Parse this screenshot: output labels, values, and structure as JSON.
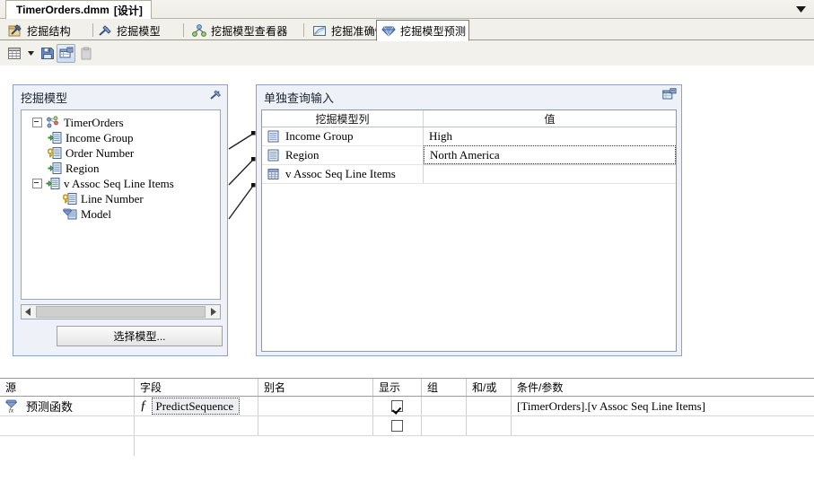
{
  "window": {
    "document_tab_title": "TimerOrders.dmm",
    "document_tab_suffix": "[设计]",
    "chevron_icon": "chevron-down-icon"
  },
  "designer_tabs": [
    {
      "label": "挖掘结构",
      "icon": "mining-structure-icon",
      "active": false
    },
    {
      "label": "挖掘模型",
      "icon": "mining-model-icon",
      "active": false
    },
    {
      "label": "挖掘模型查看器",
      "icon": "mining-model-viewer-icon",
      "active": false
    },
    {
      "label": "挖掘准确性图表",
      "icon": "mining-accuracy-chart-icon",
      "active": false
    },
    {
      "label": "挖掘模型预测",
      "icon": "mining-model-prediction-icon",
      "active": true
    }
  ],
  "toolbar": {
    "buttons": [
      {
        "name": "view-grid-button",
        "icon": "grid-icon",
        "state": "normal"
      },
      {
        "name": "view-dropdown-button",
        "icon": "chevron-down-icon",
        "state": "normal"
      },
      {
        "name": "save-button",
        "icon": "save-icon",
        "state": "normal"
      },
      {
        "name": "singleton-query-button",
        "icon": "singleton-query-icon",
        "state": "pressed"
      },
      {
        "name": "paste-button",
        "icon": "paste-icon",
        "state": "disabled"
      }
    ]
  },
  "mining_model_panel": {
    "title": "挖掘模型",
    "collapse_icon": "collapse-chevron-icon",
    "tree": [
      {
        "label": "TimerOrders",
        "level": 0,
        "icon": "mining-model-node-icon",
        "expander": "minus"
      },
      {
        "label": "Income Group",
        "level": 1,
        "icon": "input-column-icon",
        "expander": null
      },
      {
        "label": "Order Number",
        "level": 1,
        "icon": "key-column-icon",
        "expander": null
      },
      {
        "label": "Region",
        "level": 1,
        "icon": "input-column-icon",
        "expander": null
      },
      {
        "label": "v Assoc Seq Line Items",
        "level": 1,
        "icon": "input-column-icon",
        "expander": "minus"
      },
      {
        "label": "Line Number",
        "level": 2,
        "icon": "key-column-icon",
        "expander": null
      },
      {
        "label": "Model",
        "level": 2,
        "icon": "predict-column-icon",
        "expander": null
      }
    ],
    "scrollbar": {
      "left_arrow": "◄",
      "right_arrow": "►"
    },
    "select_model_button": "选择模型..."
  },
  "query_input_panel": {
    "title": "单独查询输入",
    "corner_icon": "restore-window-icon",
    "columns": [
      "挖掘模型列",
      "值"
    ],
    "rows": [
      {
        "column": "Income Group",
        "value": "High",
        "icon": "table-column-icon",
        "selected": false
      },
      {
        "column": "Region",
        "value": "North America",
        "icon": "table-column-icon",
        "selected": true
      },
      {
        "column": "v Assoc Seq Line Items",
        "value": "",
        "icon": "nested-table-icon",
        "selected": false
      }
    ]
  },
  "query_builder_grid": {
    "columns": [
      "源",
      "字段",
      "别名",
      "显示",
      "组",
      "和/或",
      "条件/参数"
    ],
    "rows": [
      {
        "source": "预测函数",
        "source_icon": "prediction-function-icon",
        "field": "PredictSequence",
        "field_prefix_icon": "function-fx-icon",
        "alias": "",
        "show": true,
        "group": "",
        "and_or": "",
        "criteria": "[TimerOrders].[v Assoc Seq Line Items]"
      },
      {
        "source": "",
        "source_icon": "",
        "field": "",
        "field_prefix_icon": "",
        "alias": "",
        "show": false,
        "group": "",
        "and_or": "",
        "criteria": ""
      }
    ]
  },
  "colors": {
    "panel_background": "#eef1f7",
    "panel_border": "#8ca2c0",
    "accent_selected_tab": "#ffffff",
    "toolbar_background": "#f2f1ec",
    "titlebar_background": "#eeede6"
  }
}
